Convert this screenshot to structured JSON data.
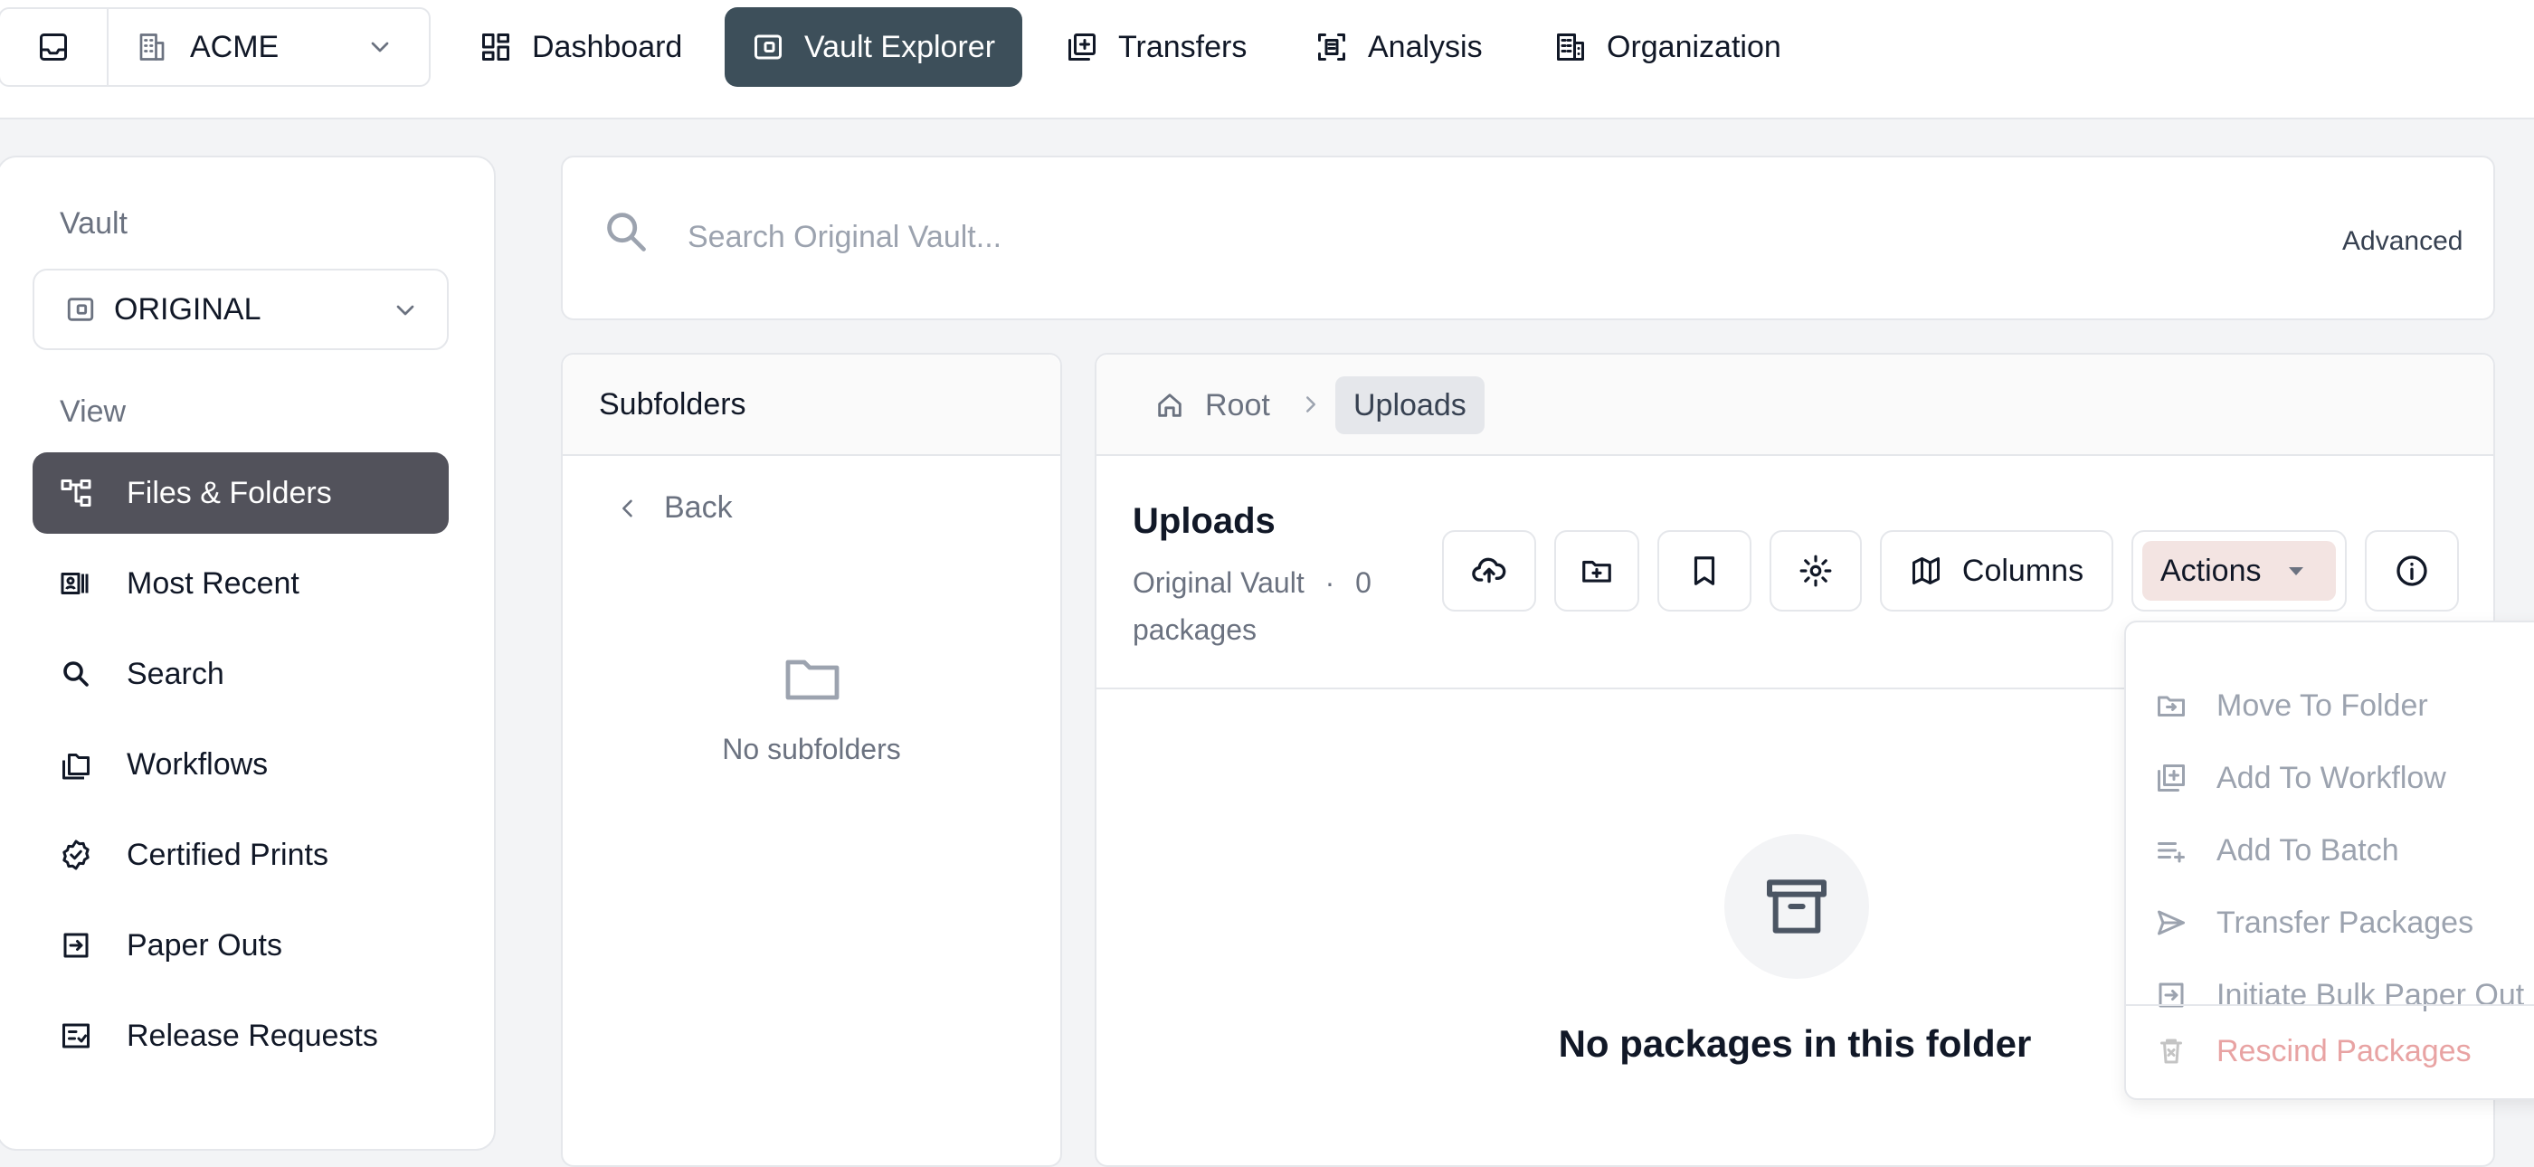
{
  "topnav": {
    "org_name": "ACME",
    "tabs": [
      {
        "label": "Dashboard",
        "icon": "dashboard-icon"
      },
      {
        "label": "Vault Explorer",
        "icon": "vault-icon",
        "active": true
      },
      {
        "label": "Transfers",
        "icon": "transfers-icon"
      },
      {
        "label": "Analysis",
        "icon": "analysis-icon"
      },
      {
        "label": "Organization",
        "icon": "building-icon"
      }
    ]
  },
  "sidebar": {
    "vault_label": "Vault",
    "vault_selected": "ORIGINAL",
    "view_label": "View",
    "items": [
      {
        "label": "Files & Folders",
        "icon": "hierarchy-icon",
        "active": true
      },
      {
        "label": "Most Recent",
        "icon": "recent-icon"
      },
      {
        "label": "Search",
        "icon": "search-icon"
      },
      {
        "label": "Workflows",
        "icon": "workflows-icon"
      },
      {
        "label": "Certified Prints",
        "icon": "certified-badge-icon"
      },
      {
        "label": "Paper Outs",
        "icon": "paper-out-icon"
      },
      {
        "label": "Release Requests",
        "icon": "release-request-icon"
      }
    ]
  },
  "search": {
    "placeholder": "Search Original Vault...",
    "value": "",
    "advanced_label": "Advanced"
  },
  "subfolders": {
    "title": "Subfolders",
    "back_label": "Back",
    "empty_text": "No subfolders"
  },
  "breadcrumb": {
    "root": "Root",
    "current": "Uploads"
  },
  "folder": {
    "title": "Uploads",
    "vault_name": "Original Vault",
    "separator": "·",
    "package_count": "0",
    "package_word": "packages",
    "empty_text": "No packages in this folder"
  },
  "toolbar": {
    "columns_label": "Columns",
    "actions_label": "Actions"
  },
  "actions_menu": {
    "items": [
      {
        "label": "Move To Folder",
        "icon": "move-to-folder-icon"
      },
      {
        "label": "Add To Workflow",
        "icon": "add-to-workflow-icon"
      },
      {
        "label": "Add To Batch",
        "icon": "add-to-batch-icon"
      },
      {
        "label": "Transfer Packages",
        "icon": "send-icon"
      },
      {
        "label": "Initiate Bulk Paper Out",
        "icon": "paper-out-icon"
      }
    ],
    "danger_item": {
      "label": "Rescind Packages",
      "icon": "trash-icon"
    }
  },
  "colors": {
    "active_tab": "#3d4f5a",
    "active_sidebar": "#52525b",
    "actions_bg": "#f3e4e2",
    "danger_text": "#e8a3a3"
  }
}
